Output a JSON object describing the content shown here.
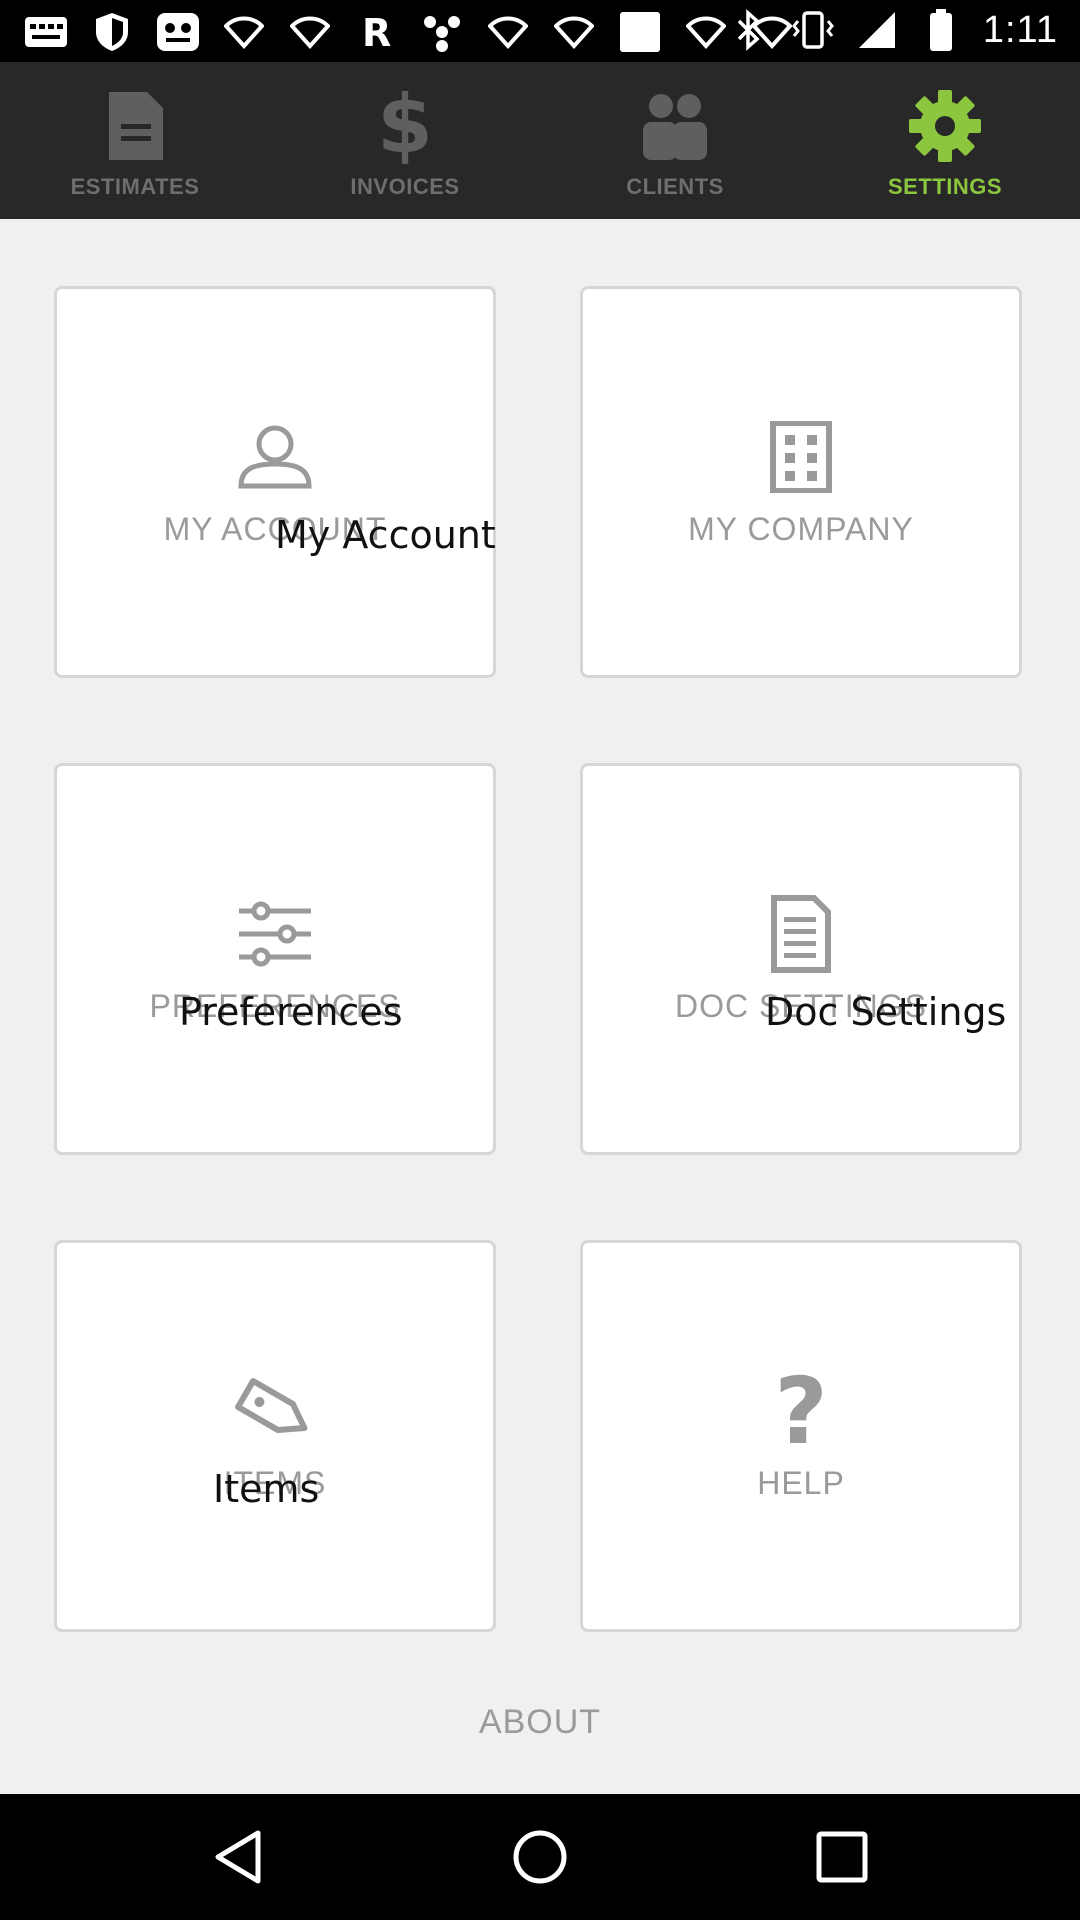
{
  "status_bar": {
    "time": "1:11",
    "left_icons": [
      "mail-icon",
      "shield-icon",
      "app-icon",
      "wifi-icon",
      "wifi-icon",
      "r-logo-icon",
      "fidget-icon",
      "wifi-icon",
      "wifi-icon",
      "square-icon",
      "wifi-icon",
      "wifi-icon"
    ],
    "right_icons": [
      "bluetooth-icon",
      "vibrate-icon",
      "signal-icon",
      "battery-icon"
    ]
  },
  "tabs": [
    {
      "label": "ESTIMATES",
      "icon": "document-icon",
      "active": false
    },
    {
      "label": "INVOICES",
      "icon": "dollar-icon",
      "active": false
    },
    {
      "label": "CLIENTS",
      "icon": "people-icon",
      "active": false
    },
    {
      "label": "SETTINGS",
      "icon": "gear-icon",
      "active": true
    }
  ],
  "colors": {
    "accent": "#8cc63e",
    "tab_bar_bg": "#282828",
    "content_bg": "#f0f0f0",
    "card_border": "#d6d6d6",
    "label_gray": "#9a9a9a"
  },
  "cards": {
    "my_account": {
      "label": "MY ACCOUNT",
      "overlay": "My Account",
      "icon": "person-icon"
    },
    "my_company": {
      "label": "MY COMPANY",
      "icon": "building-icon"
    },
    "preferences": {
      "label": "PREFERENCES",
      "overlay": "Preferences",
      "icon": "sliders-icon"
    },
    "doc_settings": {
      "label": "DOC SETTINGS",
      "overlay": "Doc Settings",
      "icon": "document-icon"
    },
    "items": {
      "label": "ITEMS",
      "overlay": "Items",
      "icon": "tag-icon"
    },
    "help": {
      "label": "HELP",
      "icon": "question-icon"
    }
  },
  "about": {
    "label": "ABOUT"
  },
  "nav_bar": [
    "back-icon",
    "home-icon",
    "recents-icon"
  ]
}
